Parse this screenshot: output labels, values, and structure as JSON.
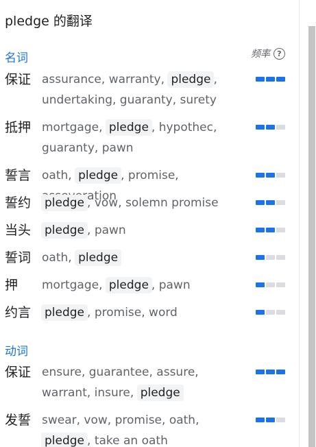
{
  "title": "pledge 的翻译",
  "freq_label": "频率",
  "help_glyph": "?",
  "colors": {
    "accent": "#1a73e8",
    "bar_off": "#dadce0",
    "highlight_bg": "#f1f3f4"
  },
  "sections": [
    {
      "label": "名词",
      "rows": [
        {
          "zh": "保证",
          "parts": [
            [
              "assurance, warranty, ",
              false
            ],
            [
              "pledge",
              true
            ],
            [
              ", undertaking, guaranty, surety",
              false
            ]
          ],
          "freq": 3
        },
        {
          "zh": "抵押",
          "parts": [
            [
              "mortgage, ",
              false
            ],
            [
              "pledge",
              true
            ],
            [
              ", hypothec, guaranty, pawn",
              false
            ]
          ],
          "freq": 2
        },
        {
          "zh": "誓言",
          "parts": [
            [
              "oath, ",
              false
            ],
            [
              "pledge",
              true
            ],
            [
              ", promise, asseveration",
              false
            ]
          ],
          "freq": 2
        },
        {
          "zh": "誓约",
          "parts": [
            [
              "pledge",
              true
            ],
            [
              ", vow, solemn promise",
              false
            ]
          ],
          "freq": 2
        },
        {
          "zh": "当头",
          "parts": [
            [
              "pledge",
              true
            ],
            [
              ", pawn",
              false
            ]
          ],
          "freq": 2
        },
        {
          "zh": "誓词",
          "parts": [
            [
              "oath, ",
              false
            ],
            [
              "pledge",
              true
            ]
          ],
          "freq": 1
        },
        {
          "zh": "押",
          "parts": [
            [
              "mortgage, ",
              false
            ],
            [
              "pledge",
              true
            ],
            [
              ", pawn",
              false
            ]
          ],
          "freq": 1
        },
        {
          "zh": "约言",
          "parts": [
            [
              "pledge",
              true
            ],
            [
              ", promise, word",
              false
            ]
          ],
          "freq": 1
        }
      ]
    },
    {
      "label": "动词",
      "rows": [
        {
          "zh": "保证",
          "parts": [
            [
              "ensure, guarantee, assure, warrant, insure, ",
              false
            ],
            [
              "pledge",
              true
            ]
          ],
          "freq": 3
        },
        {
          "zh": "发誓",
          "parts": [
            [
              "swear, vow, promise, oath, ",
              false
            ],
            [
              "pledge",
              true
            ],
            [
              ", take an oath",
              false
            ]
          ],
          "freq": 2
        }
      ]
    }
  ]
}
